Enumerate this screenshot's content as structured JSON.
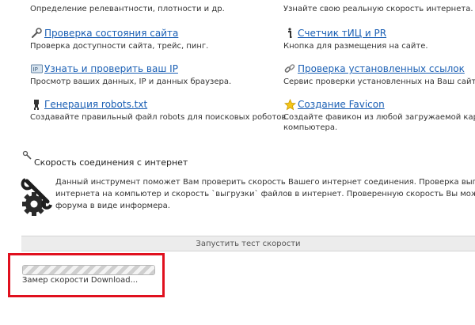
{
  "tools": {
    "relevance": {
      "desc": "Определение релевантности, плотности и др."
    },
    "real_speed": {
      "desc": "Узнайте свою реальную скорость интернета."
    },
    "site_status": {
      "title": "Проверка состояния сайта",
      "desc": "Проверка доступности сайта, трейс, пинг."
    },
    "tic_pr": {
      "title": "Счетчик тИЦ и PR",
      "desc": "Кнопка для размещения на сайте."
    },
    "ip_check": {
      "title": "Узнать и проверить ваш IP",
      "desc": "Просмотр ваших данных, IP и данных браузера."
    },
    "links_check": {
      "title": "Проверка установленных ссылок",
      "desc": "Сервис проверки установленных на Ваш сайт ссылок"
    },
    "robots": {
      "title": "Генерация robots.txt",
      "desc": "Создавайте правильный файл robots для поисковых роботов."
    },
    "favicon": {
      "title": "Создание Favicon",
      "desc_line1": "Создайте фавикон из любой загружаемой картинки",
      "desc_line2": "компьютера."
    }
  },
  "speed_test": {
    "title": "Скорость соединения с интернет",
    "desc_line1": "Данный инструмент поможет Вам проверить скорость Вашего интернет соединения. Проверка выполняется на",
    "desc_line2": "интернета на компьютер и скорость `выгрузки` файлов в интернет. Проверенную скорость Вы можете сохран",
    "desc_line3": "форума в виде информера.",
    "start_label": "Запустить тест скорости",
    "progress_status": "Замер скорости Download...",
    "progress": 1.0
  },
  "colors": {
    "link": "#1a5fb4",
    "highlight": "#e0101e"
  }
}
